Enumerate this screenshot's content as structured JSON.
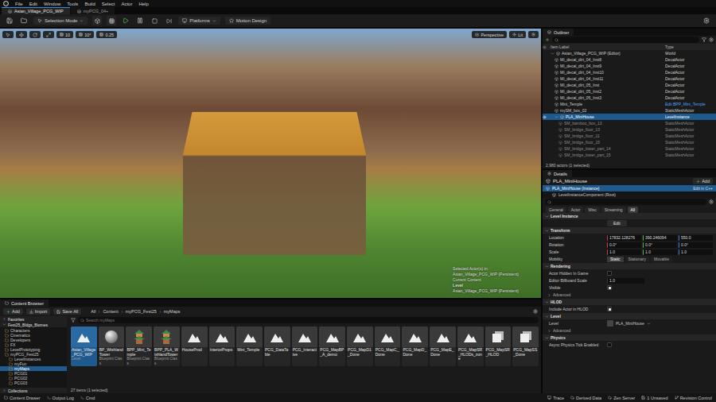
{
  "menu": [
    "File",
    "Edit",
    "Window",
    "Tools",
    "Build",
    "Select",
    "Actor",
    "Help"
  ],
  "tabs": [
    {
      "label": "Asian_Village_PCG_WIP",
      "selected": true
    },
    {
      "label": "myPCG_04+",
      "selected": false
    }
  ],
  "toolbar": {
    "mode": "Selection Mode",
    "platforms": "Platforms",
    "motion": "Motion Design"
  },
  "viewport": {
    "left_tools": [
      "10",
      "10°",
      "0.25"
    ],
    "view": "Perspective",
    "lit": "Lit",
    "overlay": [
      {
        "text": "Selected Actor(s) in:",
        "kind": "plain"
      },
      {
        "text": "Asian_Village_PCG_WIP (Persistent)",
        "kind": "plain"
      },
      {
        "text": "Current Content",
        "kind": "plain"
      },
      {
        "text": "Level",
        "kind": "bold"
      },
      {
        "text": "Asian_Village_PCG_WIP (Persistent)",
        "kind": "plain"
      }
    ]
  },
  "outliner": {
    "title": "Outliner",
    "columns": [
      "Item Label",
      "Type"
    ],
    "rows": [
      {
        "label": "Asian_Village_PCG_WIP (Editor)",
        "type": "World",
        "selected": false,
        "greyed": false,
        "link": false,
        "expanded": true,
        "children": [
          {
            "label": "MI_decal_dirt_04_Inst8",
            "type": "DecalActor",
            "selected": false,
            "greyed": false,
            "link": false
          },
          {
            "label": "MI_decal_dirt_04_Inst9",
            "type": "DecalActor",
            "selected": false,
            "greyed": false,
            "link": false
          },
          {
            "label": "MI_decal_dirt_04_Inst10",
            "type": "DecalActor",
            "selected": false,
            "greyed": false,
            "link": false
          },
          {
            "label": "MI_decal_dirt_04_Inst11",
            "type": "DecalActor",
            "selected": false,
            "greyed": false,
            "link": false
          },
          {
            "label": "MI_decal_dirt_05_Inst",
            "type": "DecalActor",
            "selected": false,
            "greyed": false,
            "link": false
          },
          {
            "label": "MI_decal_dirt_05_Inst2",
            "type": "DecalActor",
            "selected": false,
            "greyed": false,
            "link": false
          },
          {
            "label": "MI_decal_dirt_05_Inst3",
            "type": "DecalActor",
            "selected": false,
            "greyed": false,
            "link": false
          },
          {
            "label": "Mini_Temple",
            "type": "Edit BPP_Mini_Temple",
            "selected": false,
            "greyed": false,
            "link": true
          },
          {
            "label": "mySM_box_02",
            "type": "StaticMeshActor",
            "selected": false,
            "greyed": false,
            "link": false
          },
          {
            "label": "PLA_MiniHouse",
            "type": "LevelInstance",
            "selected": true,
            "greyed": false,
            "link": false,
            "expanded": true,
            "children": [
              {
                "label": "SM_bamboo_box_13",
                "type": "StaticMeshActor",
                "selected": false,
                "greyed": true,
                "link": false
              },
              {
                "label": "SM_bridge_floor_13",
                "type": "StaticMeshActor",
                "selected": false,
                "greyed": true,
                "link": false
              },
              {
                "label": "SM_bridge_floor_11",
                "type": "StaticMeshActor",
                "selected": false,
                "greyed": true,
                "link": false
              },
              {
                "label": "SM_bridge_floor_15",
                "type": "StaticMeshActor",
                "selected": false,
                "greyed": true,
                "link": false
              },
              {
                "label": "SM_bridge_lower_part_14",
                "type": "StaticMeshActor",
                "selected": false,
                "greyed": true,
                "link": false
              },
              {
                "label": "SM_bridge_lower_part_15",
                "type": "StaticMeshActor",
                "selected": false,
                "greyed": true,
                "link": false
              }
            ]
          }
        ]
      }
    ],
    "footer": "2,980 actors (1 selected)"
  },
  "details": {
    "title": "Details",
    "name": "PLA_MiniHouse",
    "add": "Add",
    "components": [
      {
        "label": "PLA_MiniHouse (Instance)",
        "action": "Edit in C++",
        "selected": true
      },
      {
        "label": "LevelInstanceComponent (Root)",
        "action": "",
        "selected": false
      }
    ],
    "filters": [
      {
        "label": "General",
        "selected": false
      },
      {
        "label": "Actor",
        "selected": false
      },
      {
        "label": "Misc",
        "selected": false
      },
      {
        "label": "Streaming",
        "selected": false
      },
      {
        "label": "All",
        "selected": true
      }
    ],
    "sections": [
      {
        "title": "Level Instance",
        "rows": [
          {
            "kind": "button",
            "label": "Edit"
          }
        ]
      },
      {
        "title": "Transform",
        "rows": [
          {
            "kind": "vector",
            "label": "Location",
            "values": [
              "17832.128276",
              "390.246094",
              "550.0"
            ]
          },
          {
            "kind": "vector",
            "label": "Rotation",
            "values": [
              "0.0°",
              "0.0°",
              "0.0°"
            ]
          },
          {
            "kind": "vector",
            "label": "Scale",
            "values": [
              "1.0",
              "1.0",
              "1.0"
            ]
          },
          {
            "kind": "choice",
            "label": "Mobility",
            "options": [
              {
                "label": "Static",
                "selected": true
              },
              {
                "label": "Stationary",
                "selected": false
              },
              {
                "label": "Movable",
                "selected": false
              }
            ]
          }
        ]
      },
      {
        "title": "Rendering",
        "rows": [
          {
            "kind": "check",
            "label": "Actor Hidden In Game",
            "checked": false
          },
          {
            "kind": "number",
            "label": "Editor Billboard Scale",
            "value": "1.0"
          },
          {
            "kind": "check",
            "label": "Visible",
            "checked": true
          },
          {
            "kind": "advanced",
            "label": "Advanced"
          }
        ]
      },
      {
        "title": "HLOD",
        "rows": [
          {
            "kind": "check",
            "label": "Include Actor in HLOD",
            "checked": true
          }
        ]
      },
      {
        "title": "Level",
        "rows": [
          {
            "kind": "asset",
            "label": "Level",
            "value": "PLA_MiniHouse"
          },
          {
            "kind": "advanced",
            "label": "Advanced"
          }
        ]
      },
      {
        "title": "Physics",
        "rows": [
          {
            "kind": "check",
            "label": "Async Physics Tick Enabled",
            "checked": false
          }
        ]
      }
    ]
  },
  "content_browser": {
    "title": "Content Browser",
    "add": "Add",
    "import": "Import",
    "save": "Save All",
    "path": [
      "All",
      "Content",
      "myPCG_Fest25",
      "myMaps"
    ],
    "favorites": "Favorites",
    "root": "Fest25_Bldgs_Biomes",
    "tree": [
      {
        "label": "Characters",
        "selected": false
      },
      {
        "label": "Cinematics",
        "selected": false
      },
      {
        "label": "Developers",
        "selected": false
      },
      {
        "label": "FX",
        "selected": false
      },
      {
        "label": "LevelPrototyping",
        "selected": false
      },
      {
        "label": "myPCG_Fest25",
        "selected": false,
        "expanded": true,
        "children": [
          {
            "label": "LevelInstances",
            "selected": false
          },
          {
            "label": "myFun",
            "selected": false
          },
          {
            "label": "myMaps",
            "selected": true
          },
          {
            "label": "PCG01",
            "selected": false
          },
          {
            "label": "PCG02",
            "selected": false
          },
          {
            "label": "PCG03",
            "selected": false
          }
        ]
      }
    ],
    "collections": "Collections",
    "search": "Search myMaps",
    "assets": [
      {
        "name": "Asian_Village_PCG_WIP",
        "type": "Level",
        "kind": "level",
        "selected": true
      },
      {
        "name": "BP_Wishland Tower",
        "type": "Blueprint Class",
        "kind": "sphere",
        "selected": false
      },
      {
        "name": "BPP_Mini_Temple",
        "type": "Blueprint Class",
        "kind": "tower",
        "selected": false
      },
      {
        "name": "BPP_PLA_WishlandTower",
        "type": "Blueprint Class",
        "kind": "tower",
        "selected": false
      },
      {
        "name": "HouseProd",
        "kind": "level",
        "selected": false
      },
      {
        "name": "InteriorProps",
        "kind": "level",
        "selected": false
      },
      {
        "name": "Mini_Temple",
        "kind": "level",
        "selected": false
      },
      {
        "name": "PCG_DataTable",
        "kind": "level",
        "selected": false
      },
      {
        "name": "PCG_Interactive",
        "kind": "level",
        "selected": false
      },
      {
        "name": "PCG_MapBP_A_demo",
        "kind": "level",
        "selected": false
      },
      {
        "name": "PCG_MapD1_Done",
        "kind": "level",
        "selected": false
      },
      {
        "name": "PCG_MapC_Done",
        "kind": "level",
        "selected": false
      },
      {
        "name": "PCG_MapD_Done",
        "kind": "level",
        "selected": false
      },
      {
        "name": "PCG_MapE_Done",
        "kind": "level",
        "selected": false
      },
      {
        "name": "PCG_MapSR_HLODs_zone",
        "kind": "level",
        "selected": false
      },
      {
        "name": "PCG_MapSR_HLOD",
        "kind": "data",
        "selected": false
      },
      {
        "name": "PCG_MapSS_Done",
        "kind": "data",
        "selected": false
      }
    ],
    "count": "27 items (1 selected)"
  },
  "status_bar": {
    "left": [
      "Content Drawer",
      "Output Log",
      "Cmd"
    ],
    "right": [
      "Trace",
      "Derived Data",
      "Zen Server",
      "1 Unsaved",
      "Revision Control"
    ]
  }
}
